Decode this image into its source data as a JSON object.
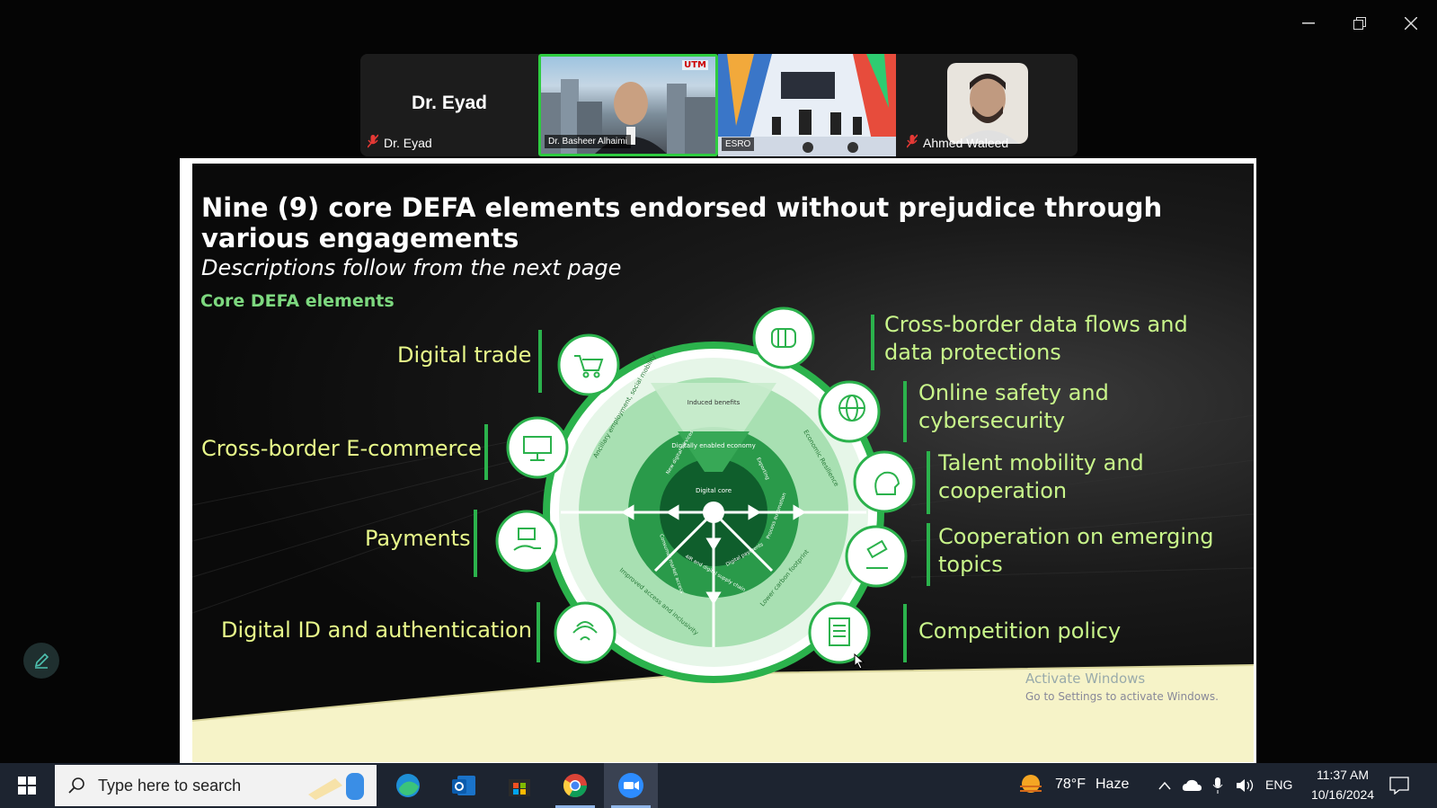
{
  "window": {
    "minimize_icon": "minimize-icon",
    "restore_icon": "restore-icon",
    "close_icon": "close-icon"
  },
  "participants": [
    {
      "name": "Dr. Eyad",
      "display": "Dr. Eyad",
      "muted": true
    },
    {
      "name": "Dr. Basheer Alhaimi",
      "badge": "UTM",
      "active_speaker": true
    },
    {
      "name": "ESRO"
    },
    {
      "name": "Ahmed Waleed",
      "muted": true
    }
  ],
  "slide": {
    "title": "Nine (9) core DEFA elements endorsed without prejudice  through various engagements",
    "subtitle": "Descriptions follow from the next page",
    "section_label": "Core DEFA elements",
    "left_elements": [
      "Digital trade",
      "Cross-border E-commerce",
      "Payments",
      "Digital ID and authentication"
    ],
    "right_elements": [
      "Cross-border data flows and data protections",
      "Online safety and cybersecurity",
      "Talent mobility and cooperation",
      "Cooperation on emerging topics",
      "Competition policy"
    ],
    "diagram": {
      "induced": "Induced benefits",
      "enabled": "Digitally enabled economy",
      "core": "Digital core",
      "ring_left_top": "Ancillary employment, social mobility",
      "ring_right_top": "Economic Resilience",
      "ring_left_bottom": "Improved access and inclusivity",
      "ring_right_bottom": "Lower carbon footprint",
      "inner_1": "New digital services",
      "inner_2": "Exporting",
      "inner_3": "Consumer market access",
      "inner_4": "Process automation",
      "inner_5": "4IR and digital supply chain",
      "inner_6": "Digital payments"
    }
  },
  "watermark": {
    "line1": "Activate Windows",
    "line2": "Go to Settings to activate Windows."
  },
  "taskbar": {
    "search_placeholder": "Type here to search",
    "weather_temp": "78°F",
    "weather_desc": "Haze",
    "lang": "ENG",
    "time": "11:37 AM",
    "date": "10/16/2024"
  },
  "colors": {
    "accent_green": "#2bb24c",
    "label_yellow": "#e8f88a",
    "taskbar_bg": "#1d2430"
  }
}
